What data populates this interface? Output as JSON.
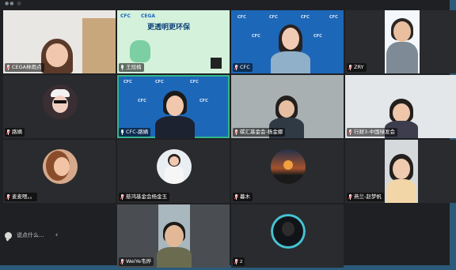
{
  "top": {
    "title": "●● ◎"
  },
  "tiles": [
    {
      "name": "CEGA林雨点"
    },
    {
      "name": "王冠楠",
      "poster_title": "更透明更环保",
      "poster_brand_left": "CFC",
      "poster_brand_right": "CEGA"
    },
    {
      "name": "CFC",
      "logo": "CFC"
    },
    {
      "name": "ZRY"
    },
    {
      "name": "路嫡"
    },
    {
      "name": "CFC-路嫡"
    },
    {
      "name": "碳汇基金会-杨金娜"
    },
    {
      "name": "行财3-中国绿发会"
    },
    {
      "name": "麦麦嗯。。"
    },
    {
      "name": "慈鸿基金会杨金玉"
    },
    {
      "name": "暮木"
    },
    {
      "name": "燕兰-赵梦帆"
    },
    {
      "name": "WeiYe韦烨"
    },
    {
      "name": "z"
    }
  ],
  "chat": {
    "placeholder": "说点什么...",
    "arrow": "‹"
  },
  "colors": {
    "active_border": "#34b58a",
    "cfc_blue": "#1d67b8",
    "tile_bg": "#2a2b2e"
  }
}
